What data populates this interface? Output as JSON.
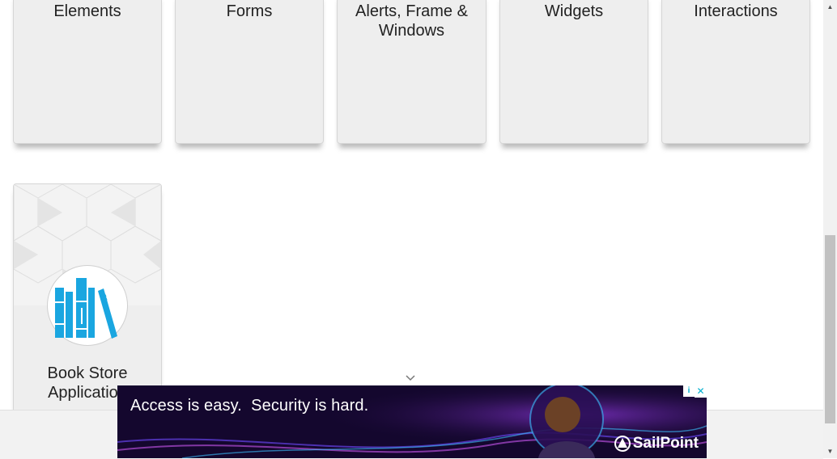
{
  "categories": [
    {
      "label": "Elements"
    },
    {
      "label": "Forms"
    },
    {
      "label": "Alerts, Frame &\nWindows"
    },
    {
      "label": "Widgets"
    },
    {
      "label": "Interactions"
    }
  ],
  "book_store": {
    "label": "Book Store\nApplication",
    "icon": "books-icon"
  },
  "ad": {
    "headline": "Access is easy.  Security is hard.",
    "brand": "SailPoint",
    "info_icon": "info-icon",
    "close_icon": "close-icon"
  },
  "colors": {
    "book_icon": "#1aa6e0",
    "ad_bg": "#14072e",
    "ad_accent": "#00aecd"
  }
}
